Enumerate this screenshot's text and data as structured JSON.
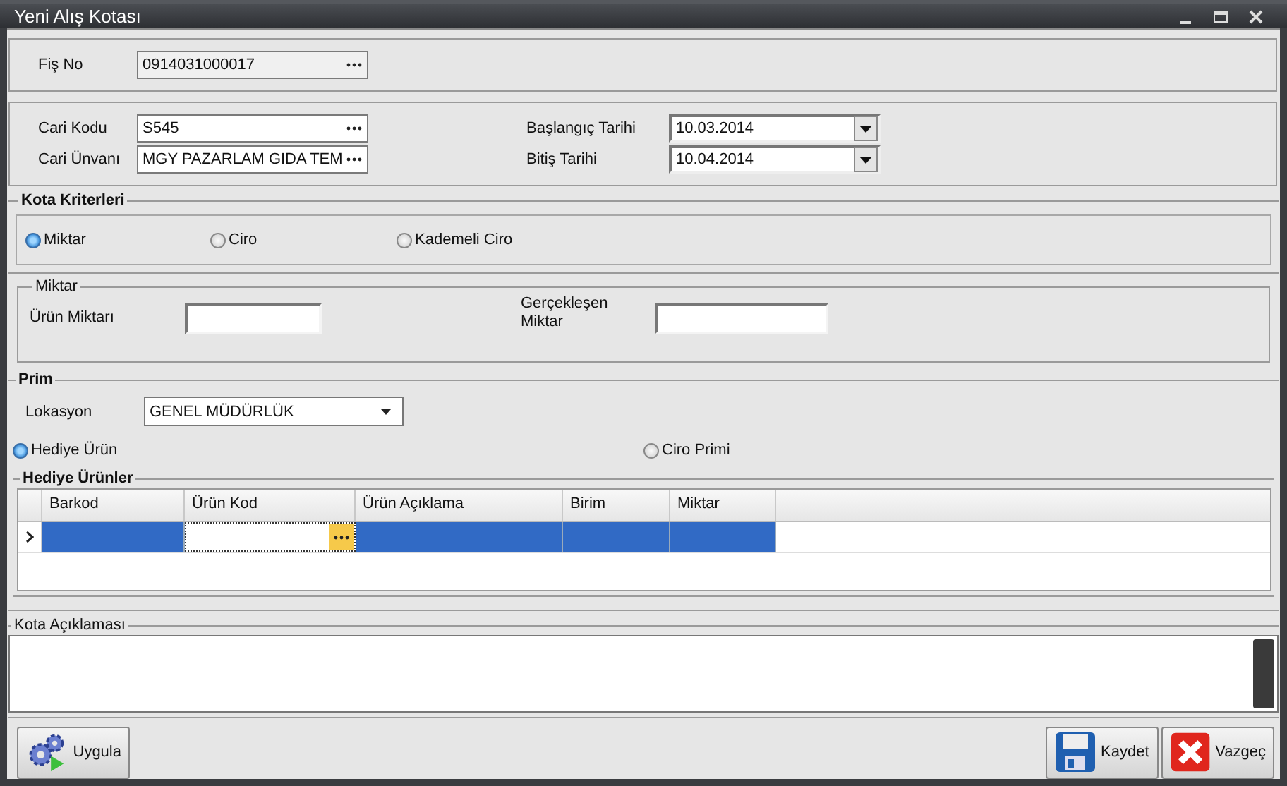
{
  "window": {
    "title": "Yeni Alış Kotası"
  },
  "fis_no": {
    "label": "Fiş No",
    "value": "0914031000017"
  },
  "cari": [
    {
      "label": "Cari Kodu",
      "value": "S545"
    },
    {
      "label": "Cari Ünvanı",
      "value": "MGY PAZARLAM GIDA TEM"
    }
  ],
  "dates": [
    {
      "label": "Başlangıç Tarihi",
      "value": "10.03.2014"
    },
    {
      "label": "Bitiş Tarihi",
      "value": "10.04.2014"
    }
  ],
  "kota_kriterleri": {
    "title": "Kota Kriterleri",
    "options": [
      {
        "label": "Miktar",
        "selected": true
      },
      {
        "label": "Ciro",
        "selected": false
      },
      {
        "label": "Kademeli Ciro",
        "selected": false
      }
    ]
  },
  "miktar": {
    "title": "Miktar",
    "fields": [
      {
        "label": "Ürün Miktarı"
      },
      {
        "label": "Gerçekleşen Miktar"
      }
    ]
  },
  "prim": {
    "title": "Prim",
    "lokasyon": {
      "label": "Lokasyon",
      "value": "GENEL MÜDÜRLÜK"
    },
    "options": [
      {
        "label": "Hediye Ürün",
        "selected": true
      },
      {
        "label": "Ciro Primi",
        "selected": false
      }
    ],
    "hediye_urunler": {
      "title": "Hediye Ürünler",
      "columns": [
        "Barkod",
        "Ürün Kod",
        "Ürün Açıklama",
        "Birim",
        "Miktar"
      ],
      "rows": [
        {
          "selected": true
        }
      ]
    }
  },
  "kota_aciklamasi": {
    "title": "Kota Açıklaması"
  },
  "buttons": [
    {
      "label": "Uygula",
      "kind": "apply"
    },
    {
      "label": "Kaydet",
      "kind": "save"
    },
    {
      "label": "Vazgeç",
      "kind": "cancel"
    }
  ]
}
